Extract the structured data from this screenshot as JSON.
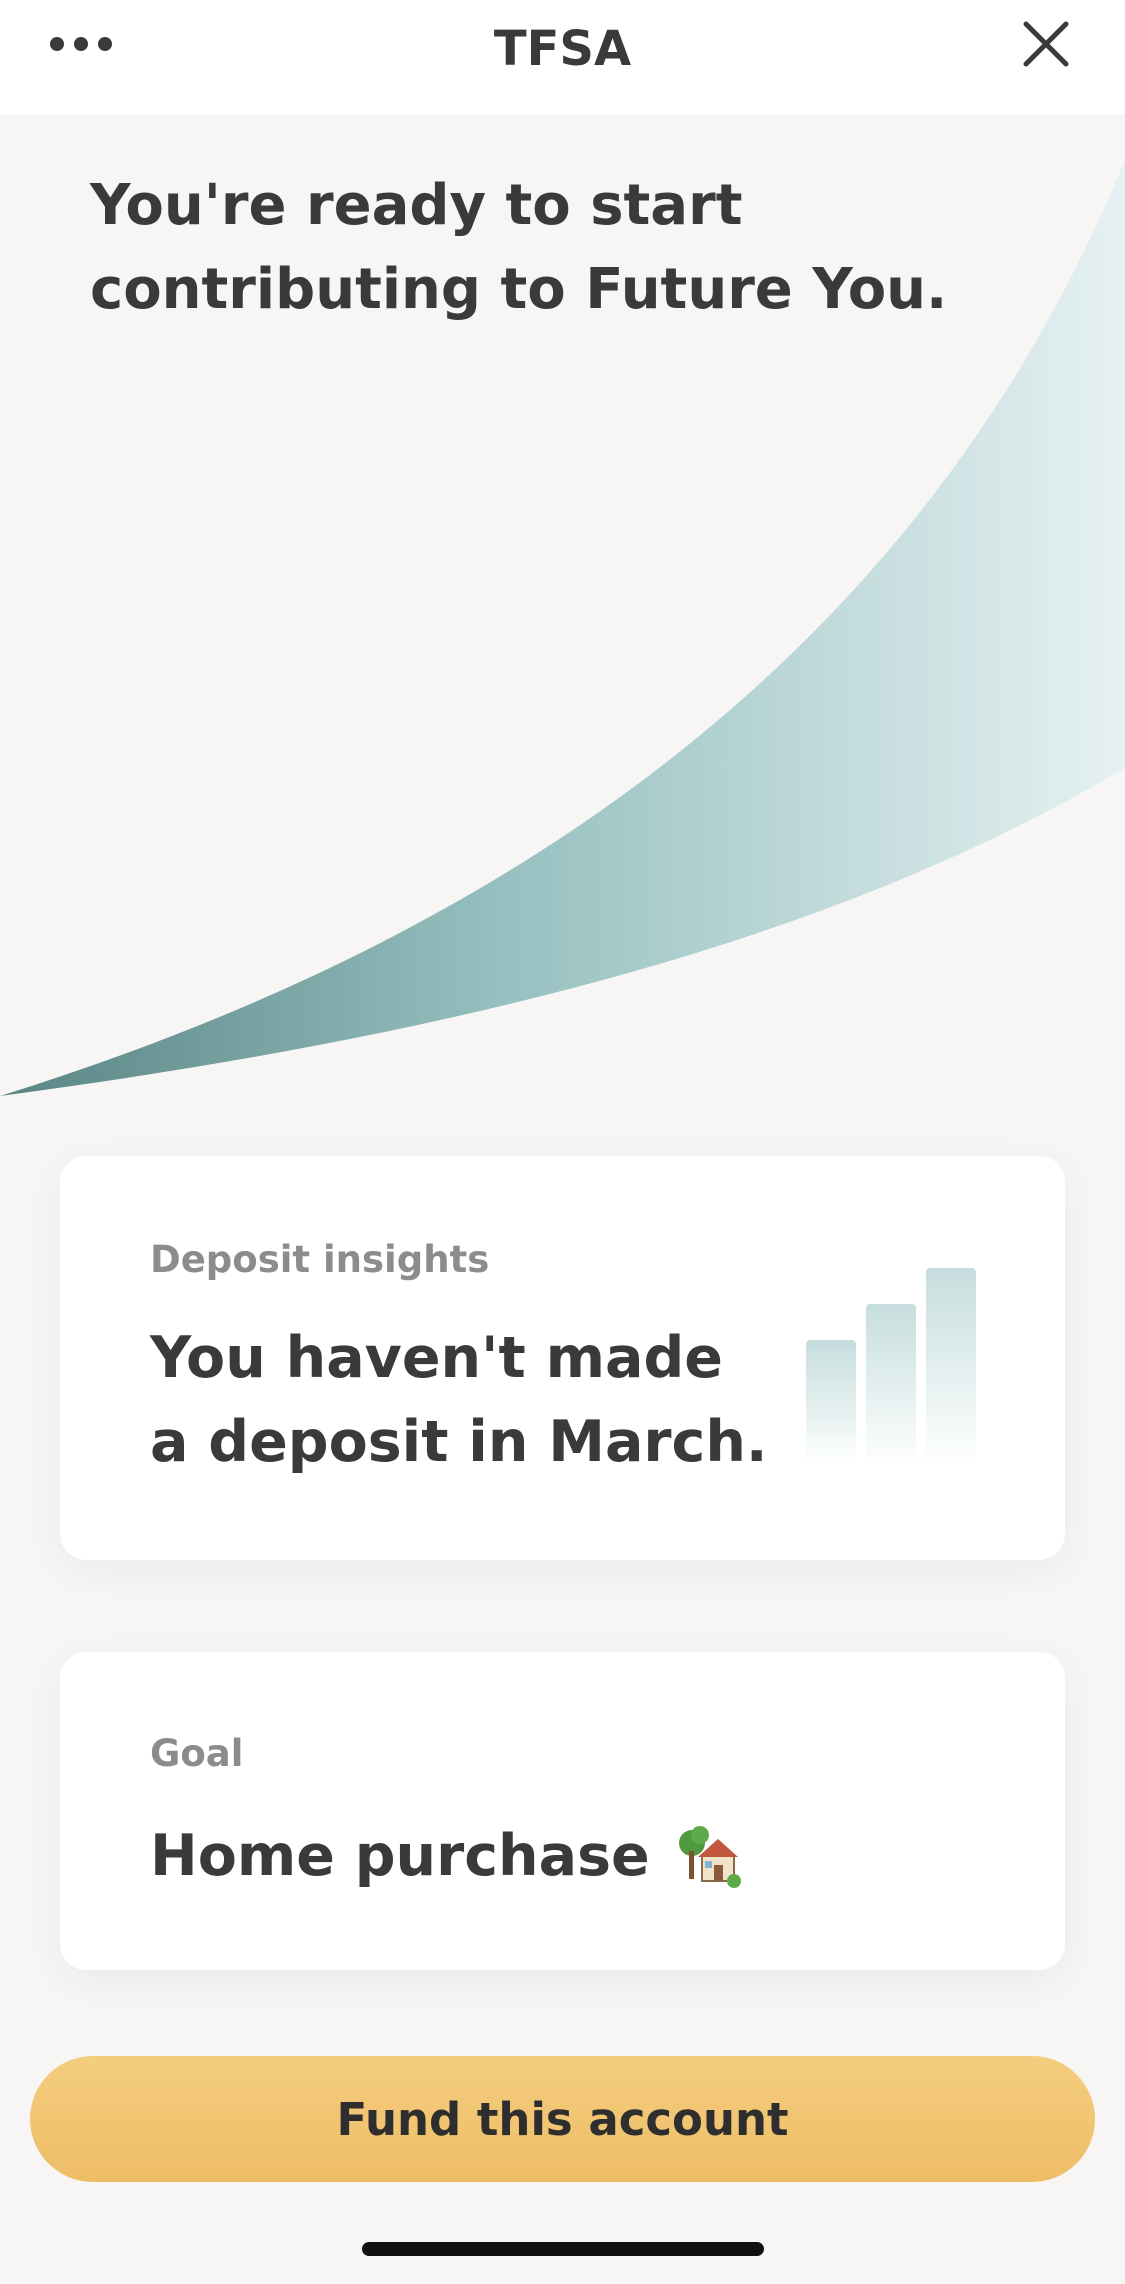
{
  "header": {
    "title": "TFSA",
    "more_icon": "ellipsis-icon",
    "close_icon": "close-x-icon"
  },
  "hero": {
    "headline": "You're ready to start contributing to Future You."
  },
  "insights_card": {
    "label": "Deposit insights",
    "text": "You haven't made a deposit in March.",
    "icon": "bar-chart-icon"
  },
  "goal_card": {
    "label": "Goal",
    "text": "Home purchase",
    "icon": "house-with-garden-icon"
  },
  "cta": {
    "label": "Fund this account"
  },
  "colors": {
    "accent_teal": "#5e8b8b",
    "button_yellow": "#f2c470",
    "background": "#f7f6f5"
  }
}
